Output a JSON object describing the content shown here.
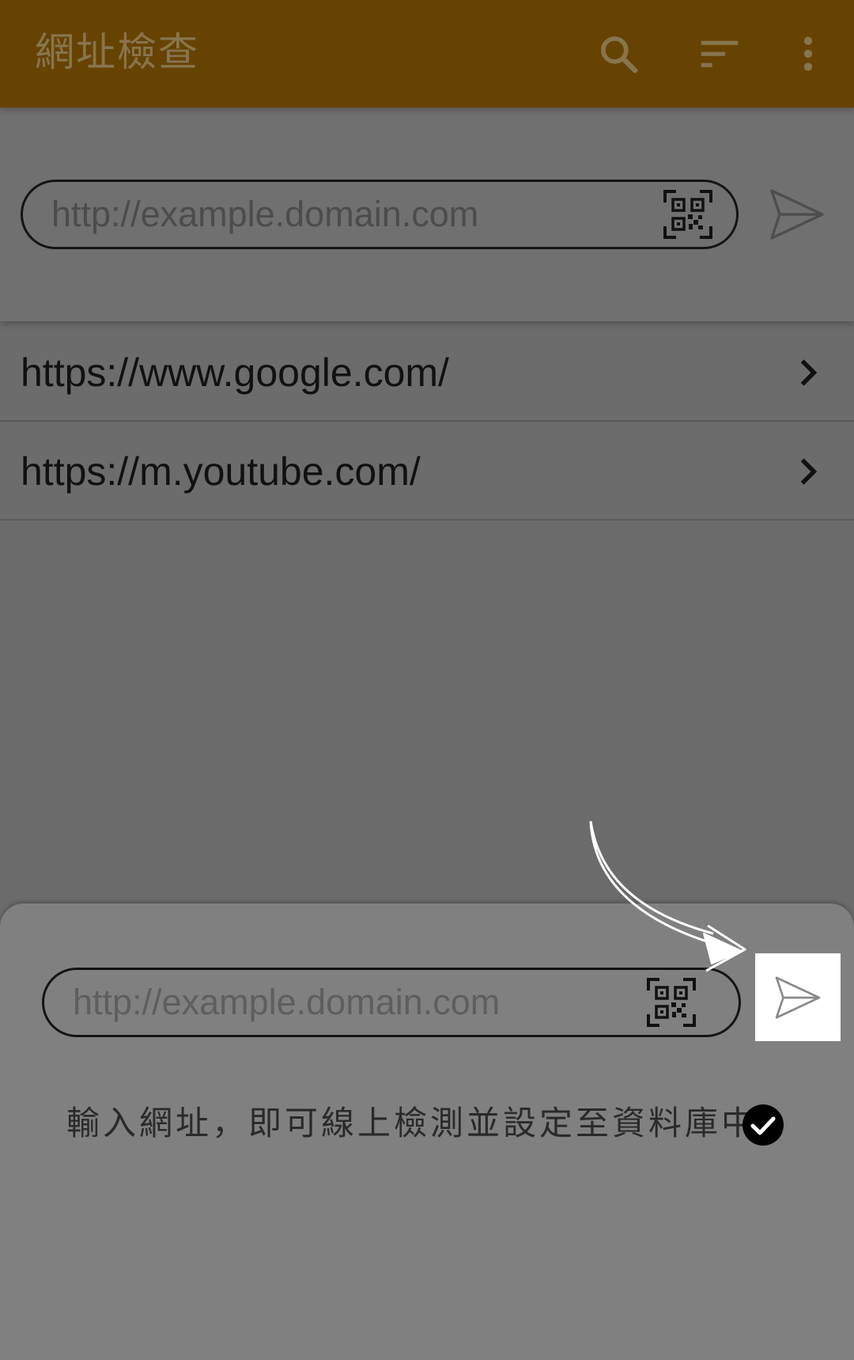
{
  "app_bar": {
    "title": "網址檢查",
    "icons": [
      "search-icon",
      "sort-icon",
      "more-vert-icon"
    ],
    "background_color": "#674301"
  },
  "url_input": {
    "placeholder": "http://example.domain.com",
    "value": "",
    "qr_icon": "qr-code-icon",
    "send_icon": "send-icon"
  },
  "url_list": {
    "items": [
      {
        "url": "https://www.google.com/"
      },
      {
        "url": "https://m.youtube.com/"
      }
    ]
  },
  "bottom_sheet": {
    "input_placeholder": "http://example.domain.com",
    "input_value": "",
    "hint_text": "輸入網址，即可線上檢測並設定至資料庫中",
    "check_icon": "check-circle-icon",
    "pointer_icon": "curved-arrow-icon"
  }
}
